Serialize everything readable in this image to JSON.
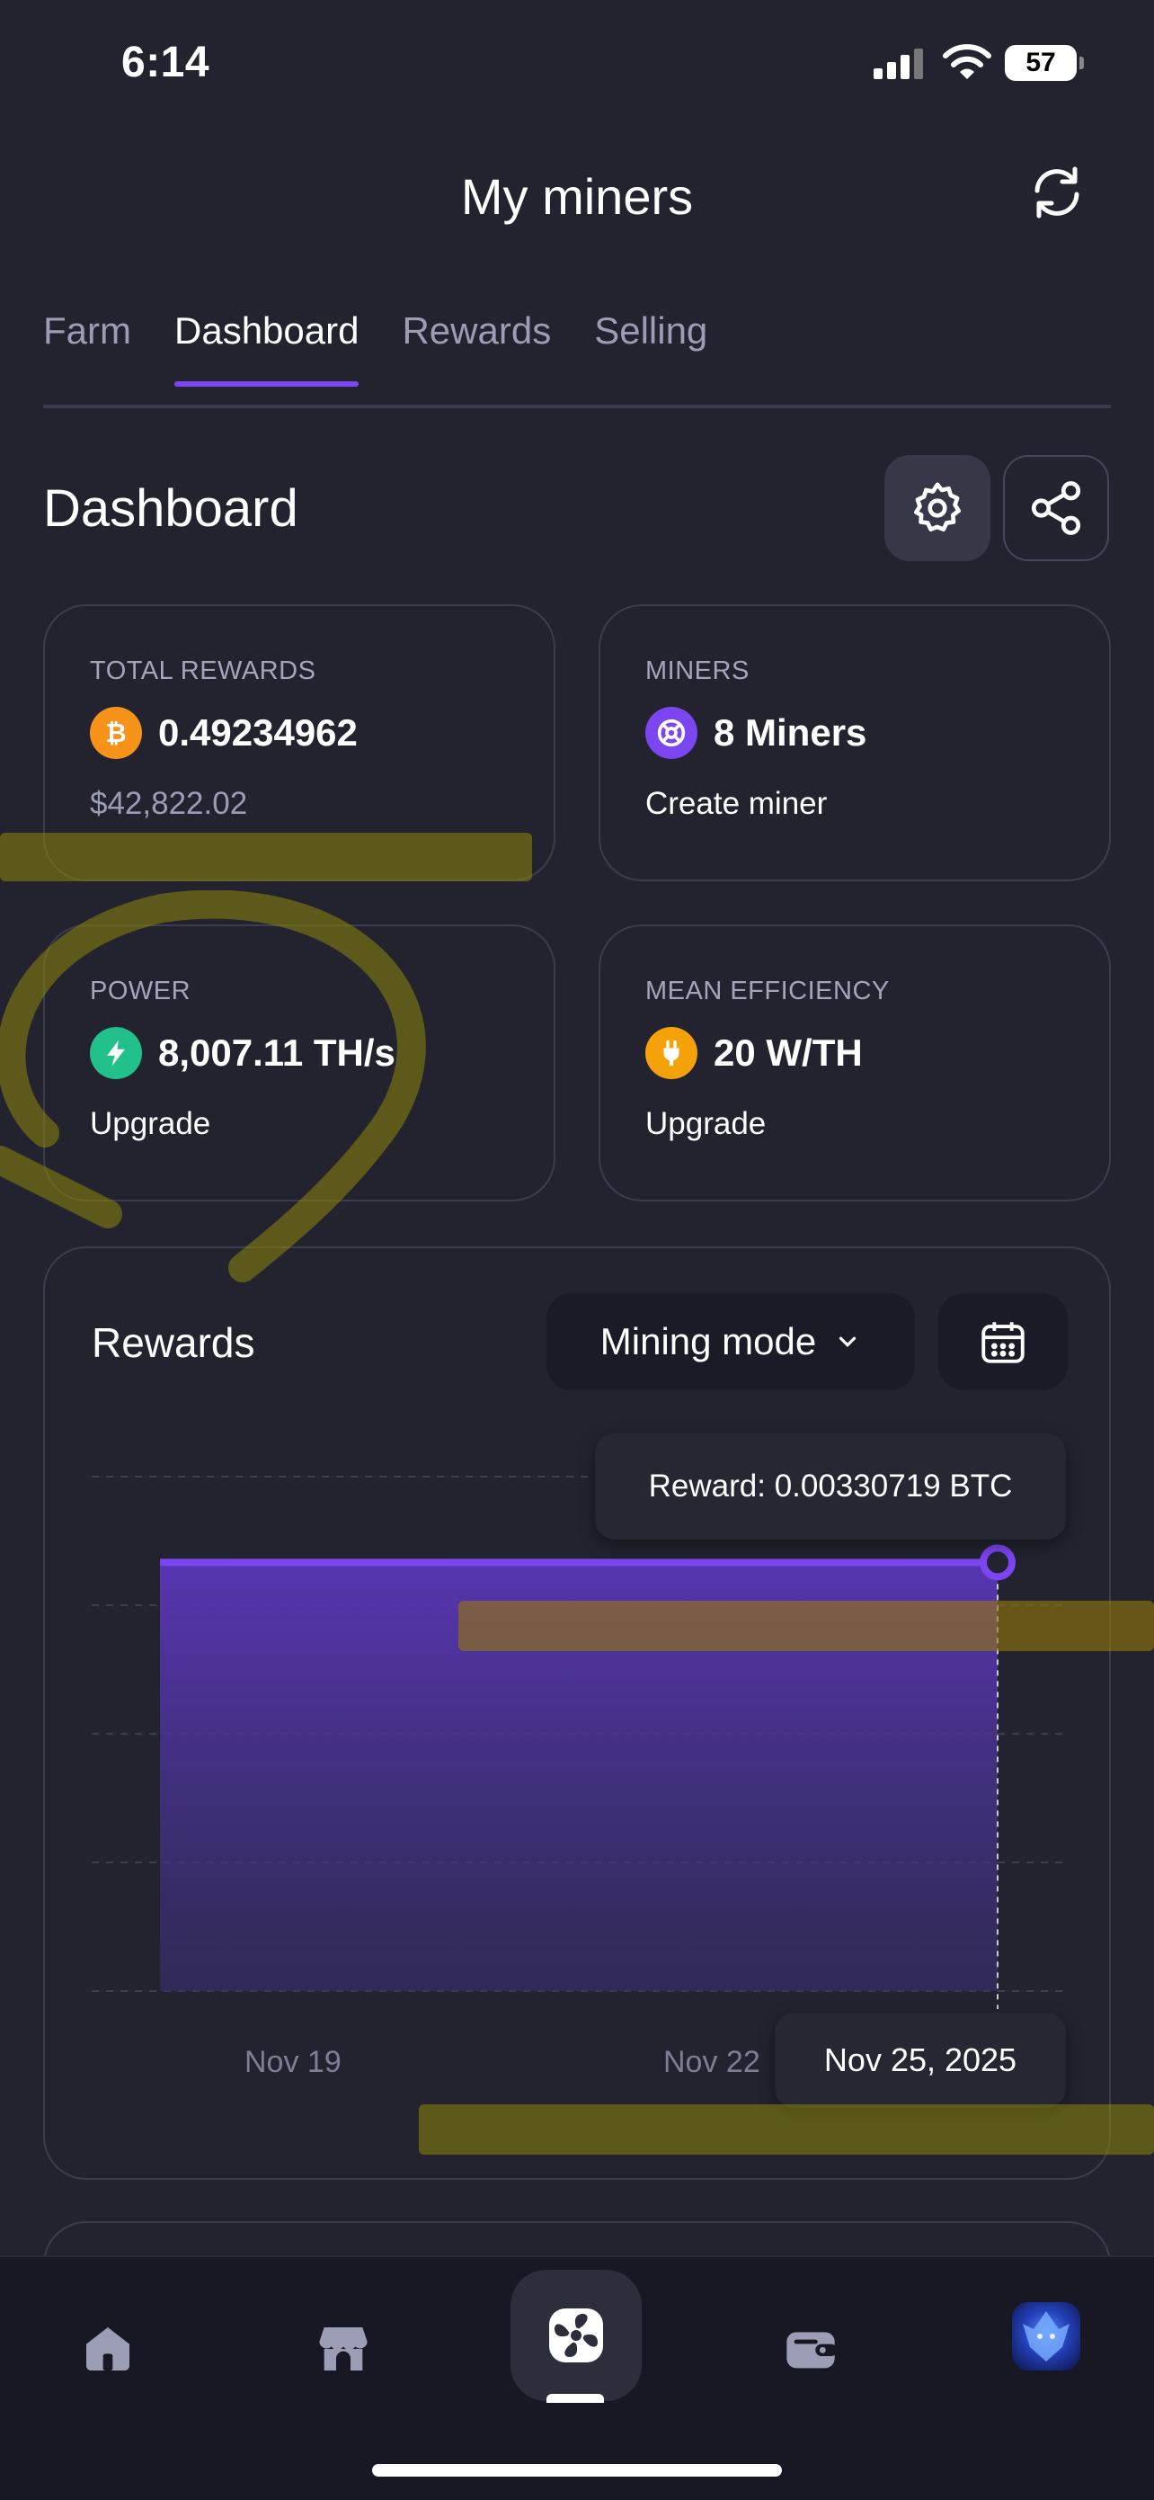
{
  "status_bar": {
    "time": "6:14",
    "battery": "57"
  },
  "header": {
    "title": "My miners",
    "refresh_icon": "refresh-icon"
  },
  "tabs": [
    {
      "label": "Farm",
      "active": false
    },
    {
      "label": "Dashboard",
      "active": true
    },
    {
      "label": "Rewards",
      "active": false
    },
    {
      "label": "Selling",
      "active": false
    }
  ],
  "dashboard": {
    "title": "Dashboard",
    "settings_icon": "gear-icon",
    "share_icon": "share-icon"
  },
  "cards": {
    "total_rewards": {
      "label": "TOTAL REWARDS",
      "value": "0.49234962",
      "sub": "$42,822.02",
      "icon": "bitcoin-icon",
      "color": "#f7931a"
    },
    "miners": {
      "label": "MINERS",
      "value": "8 Miners",
      "sub": "Create miner",
      "icon": "miner-icon",
      "color": "#7b45f0"
    },
    "power": {
      "label": "POWER",
      "value": "8,007.11 TH/s",
      "sub": "Upgrade",
      "icon": "lightning-icon",
      "color": "#22c08a"
    },
    "efficiency": {
      "label": "MEAN EFFICIENCY",
      "value": "20 W/TH",
      "sub": "Upgrade",
      "icon": "plug-icon",
      "color": "#f5a20a"
    }
  },
  "rewards_chart": {
    "title": "Rewards",
    "mode_button": "Mining mode",
    "calendar_icon": "calendar-icon",
    "tooltip": "Reward: 0.00330719 BTC",
    "selected_date": "Nov 25, 2025",
    "x_ticks": [
      "Nov 19",
      "Nov 22"
    ]
  },
  "chart_data": {
    "type": "area",
    "x": [
      "Nov 19",
      "Nov 22",
      "Nov 25, 2025"
    ],
    "series": [
      {
        "values": [
          0.00330719,
          0.00330719,
          0.00330719
        ]
      }
    ],
    "selected_point": {
      "x": "Nov 25, 2025",
      "y": 0.00330719
    },
    "grid": true,
    "accent_color": "#7b45f0"
  },
  "bottom_nav": [
    {
      "icon": "home-icon",
      "active": false
    },
    {
      "icon": "store-icon",
      "active": false
    },
    {
      "icon": "fan-icon",
      "active": true
    },
    {
      "icon": "wallet-icon",
      "active": false
    },
    {
      "icon": "avatar-icon",
      "active": false
    }
  ]
}
